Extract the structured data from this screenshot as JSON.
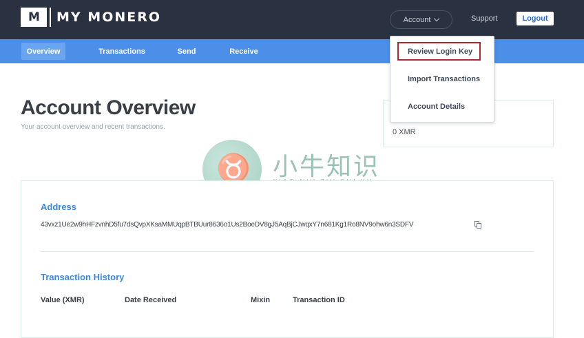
{
  "header": {
    "logo_mark": "M",
    "logo_text": "MY MONERO",
    "account_label": "Account",
    "support_label": "Support",
    "logout_label": "Logout"
  },
  "nav": {
    "tabs": [
      {
        "label": "Overview",
        "active": true
      },
      {
        "label": "Transactions",
        "active": false
      },
      {
        "label": "Send",
        "active": false
      },
      {
        "label": "Receive",
        "active": false
      }
    ]
  },
  "dropdown": {
    "items": [
      "Review Login Key",
      "Import Transactions",
      "Account Details"
    ],
    "highlighted": "Review Login Key"
  },
  "page": {
    "title": "Account Overview",
    "subtitle": "Your account overview and recent transactions."
  },
  "balance": {
    "value": "0 XMR"
  },
  "address": {
    "label": "Address",
    "value": "43vxz1Ue2w9hHFzvnhD5fu7dsQvpXKsaMMUqpBTBUur8636o1Us2BoeDV8gJ5AqBjCJwqxY7n681Kg1Ro8NV9ohw6n3SDFV"
  },
  "history": {
    "label": "Transaction History",
    "columns": [
      "Value (XMR)",
      "Date Received",
      "Mixin",
      "Transaction ID"
    ]
  },
  "watermark": {
    "cn": "小牛知识库",
    "en": "XIAO NIU ZHI SHI KU"
  },
  "colors": {
    "topbar": "#2a3140",
    "navbar": "#4b8fe8",
    "accent": "#3b86e0",
    "highlight_border": "#b0282a"
  }
}
